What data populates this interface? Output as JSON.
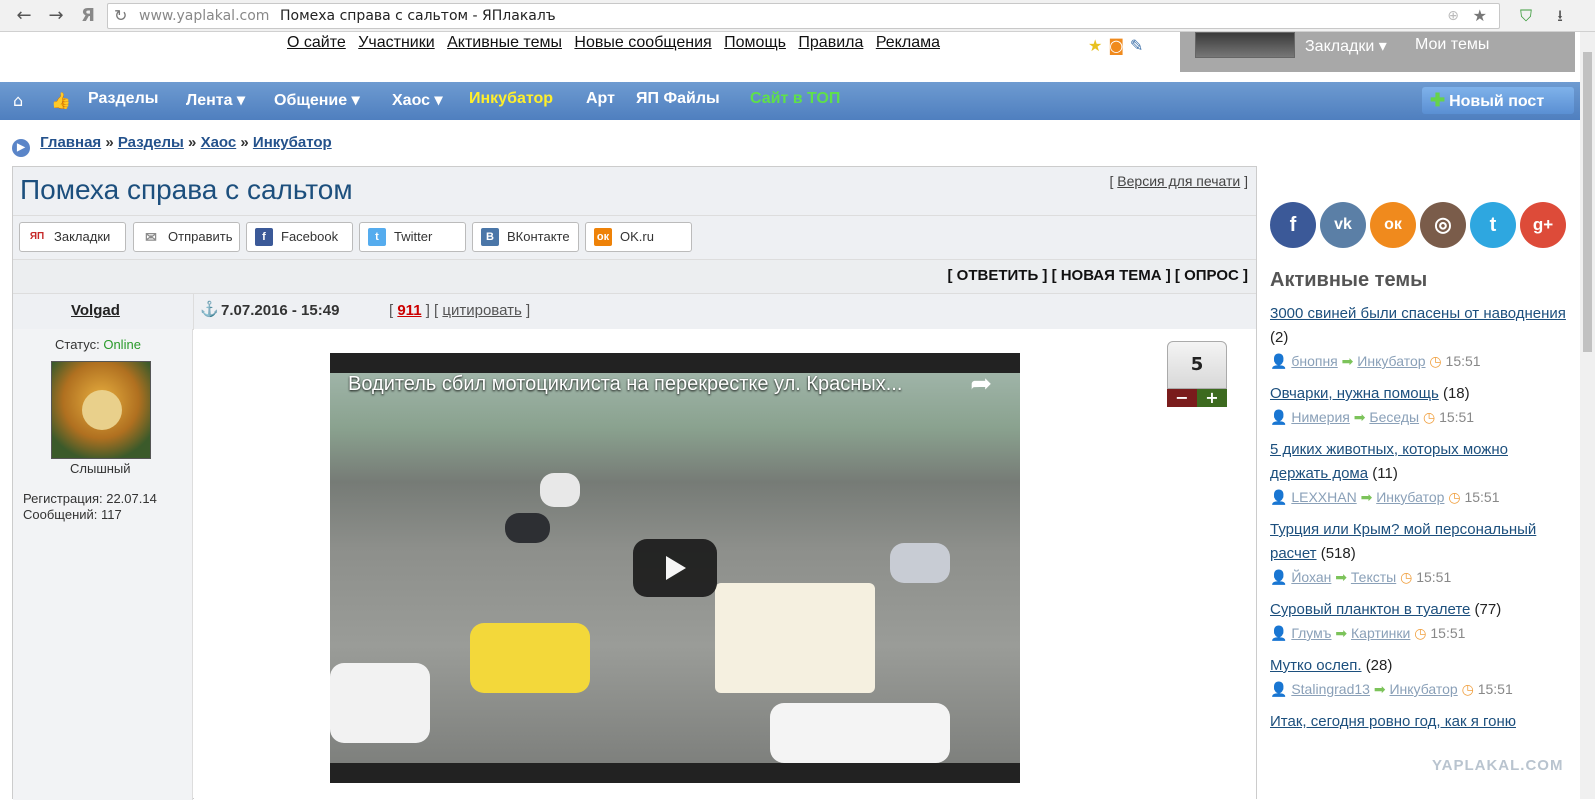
{
  "browser": {
    "domain": "www.yaplakal.com",
    "page_title": "Помеха справа с сальтом - ЯПлакалъ",
    "back_icon": "←",
    "forward_icon": "→",
    "ya_icon": "Я"
  },
  "top_links": [
    "О сайте",
    "Участники",
    "Активные темы",
    "Новые сообщения",
    "Помощь",
    "Правила",
    "Реклама"
  ],
  "userbar": {
    "bookmarks": "Закладки ▾",
    "my_topics": "Мои темы"
  },
  "nav": {
    "items": [
      {
        "label": "Разделы",
        "style": "white"
      },
      {
        "label": "Лента ▾",
        "style": "white"
      },
      {
        "label": "Общение ▾",
        "style": "white"
      },
      {
        "label": "Хаос ▾",
        "style": "white"
      },
      {
        "label": "Инкубатор",
        "style": "yellow"
      },
      {
        "label": "Арт",
        "style": "white"
      },
      {
        "label": "ЯП Файлы",
        "style": "white"
      },
      {
        "label": "Сайт в ТОП",
        "style": "green"
      }
    ],
    "new_post": "Новый пост"
  },
  "breadcrumb": {
    "home": "Главная",
    "sections": "Разделы",
    "chaos": "Хаос",
    "incubator": "Инкубатор",
    "sep": "»"
  },
  "topic": {
    "title": "Помеха справа с сальтом",
    "print_label": "Версия для печати",
    "share": [
      {
        "label": "Закладки",
        "icon": "ЯП",
        "color": "#c62828"
      },
      {
        "label": "Отправить",
        "icon": "✉",
        "color": "#8c8c8c"
      },
      {
        "label": "Facebook",
        "icon": "f",
        "color": "#3b5998"
      },
      {
        "label": "Twitter",
        "icon": "t",
        "color": "#55acee"
      },
      {
        "label": "ВКонтакте",
        "icon": "В",
        "color": "#4a76a8"
      },
      {
        "label": "OK.ru",
        "icon": "ок",
        "color": "#ee8208"
      }
    ],
    "actions": "[ ОТВЕТИТЬ ] [ НОВАЯ ТЕМА ] [ ОПРОС ]"
  },
  "post": {
    "author": "Volgad",
    "status_label": "Статус:",
    "status_value": "Online",
    "rank": "Слышный",
    "registration": "Регистрация: 22.07.14",
    "messages": "Сообщений: 117",
    "date": "7.07.2016 - 15:49",
    "post_number": "911",
    "quote_label": "цитировать",
    "rating": "5",
    "video_title": "Водитель сбил мотоциклиста на перекрестке ул. Красных..."
  },
  "sidebar": {
    "socials": [
      {
        "name": "facebook",
        "glyph": "f",
        "color": "#3b5998"
      },
      {
        "name": "vk",
        "glyph": "vk",
        "color": "#5b7fa6"
      },
      {
        "name": "odnoklassniki",
        "glyph": "ок",
        "color": "#f08a1d"
      },
      {
        "name": "instagram",
        "glyph": "◎",
        "color": "#7a5c4a"
      },
      {
        "name": "twitter",
        "glyph": "t",
        "color": "#2ea7e0"
      },
      {
        "name": "google-plus",
        "glyph": "g+",
        "color": "#dd4b39"
      }
    ],
    "heading": "Активные темы",
    "topics": [
      {
        "title": "3000 свиней были спасены от наводнения",
        "count": "(2)",
        "user": "бнопня",
        "section": "Инкубатор",
        "time": "15:51"
      },
      {
        "title": "Овчарки, нужна помощь",
        "count": "(18)",
        "user": "Нимерия",
        "section": "Беседы",
        "time": "15:51"
      },
      {
        "title": "5 диких животных, которых можно держать дома",
        "count": "(11)",
        "user": "LEXXHAN",
        "section": "Инкубатор",
        "time": "15:51"
      },
      {
        "title": "Турция или Крым? мой персональный расчет",
        "count": "(518)",
        "user": "Йохан",
        "section": "Тексты",
        "time": "15:51"
      },
      {
        "title": "Суровый планктон в туалете",
        "count": "(77)",
        "user": "Глумъ",
        "section": "Картинки",
        "time": "15:51"
      },
      {
        "title": "Мутко ослеп.",
        "count": "(28)",
        "user": "Stalingrad13",
        "section": "Инкубатор",
        "time": "15:51"
      },
      {
        "title": "Итак, сегодня ровно год, как я гоню",
        "count": "",
        "user": "",
        "section": "",
        "time": ""
      }
    ]
  },
  "watermark": "YAPLAKAL.COM"
}
